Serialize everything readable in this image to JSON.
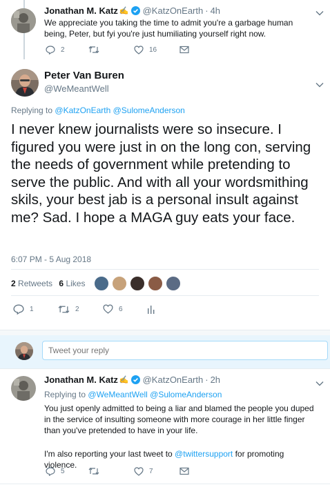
{
  "tweet1": {
    "name": "Jonathan M. Katz",
    "name_emoji": "✍️",
    "handle": "@KatzOnEarth",
    "time": "4h",
    "text": "We appreciate you taking the time to admit you're a garbage human being, Peter, but fyi you're just humiliating yourself right now.",
    "reply_count": "2",
    "like_count": "16"
  },
  "tweet2": {
    "name": "Peter Van Buren",
    "handle": "@WeMeantWell",
    "replying_prefix": "Replying to",
    "replying_to": "@KatzOnEarth @SulomeAnderson",
    "text": "I never knew journalists were so insecure. I figured you were just in on the long con, serving the needs of government while pretending to serve the public. And with all your wordsmithing skils, your best jab is a personal insult against me? Sad. I hope a MAGA guy eats your face.",
    "timestamp": "6:07 PM - 5 Aug 2018",
    "retweets_num": "2",
    "retweets_label": "Retweets",
    "likes_num": "6",
    "likes_label": "Likes",
    "reply_count": "1",
    "retweet_count": "2",
    "like_count": "6"
  },
  "reply_box": {
    "placeholder": "Tweet your reply"
  },
  "tweet3": {
    "name": "Jonathan M. Katz",
    "name_emoji": "✍️",
    "handle": "@KatzOnEarth",
    "time": "2h",
    "replying_prefix": "Replying to",
    "replying_to": "@WeMeantWell @SulomeAnderson",
    "text1": "You just openly admitted to being a liar and blamed the people you duped in the service of insulting someone with more courage in her little finger than you've pretended to have in your life.",
    "text2_before": "I'm also reporting your last tweet to ",
    "text2_link": "@twittersupport",
    "text2_after": " for promoting violence.",
    "reply_count": "5",
    "like_count": "7"
  },
  "colors": {
    "accent": "#1da1f2",
    "verified": "#1da1f2",
    "muted": "#657786"
  }
}
